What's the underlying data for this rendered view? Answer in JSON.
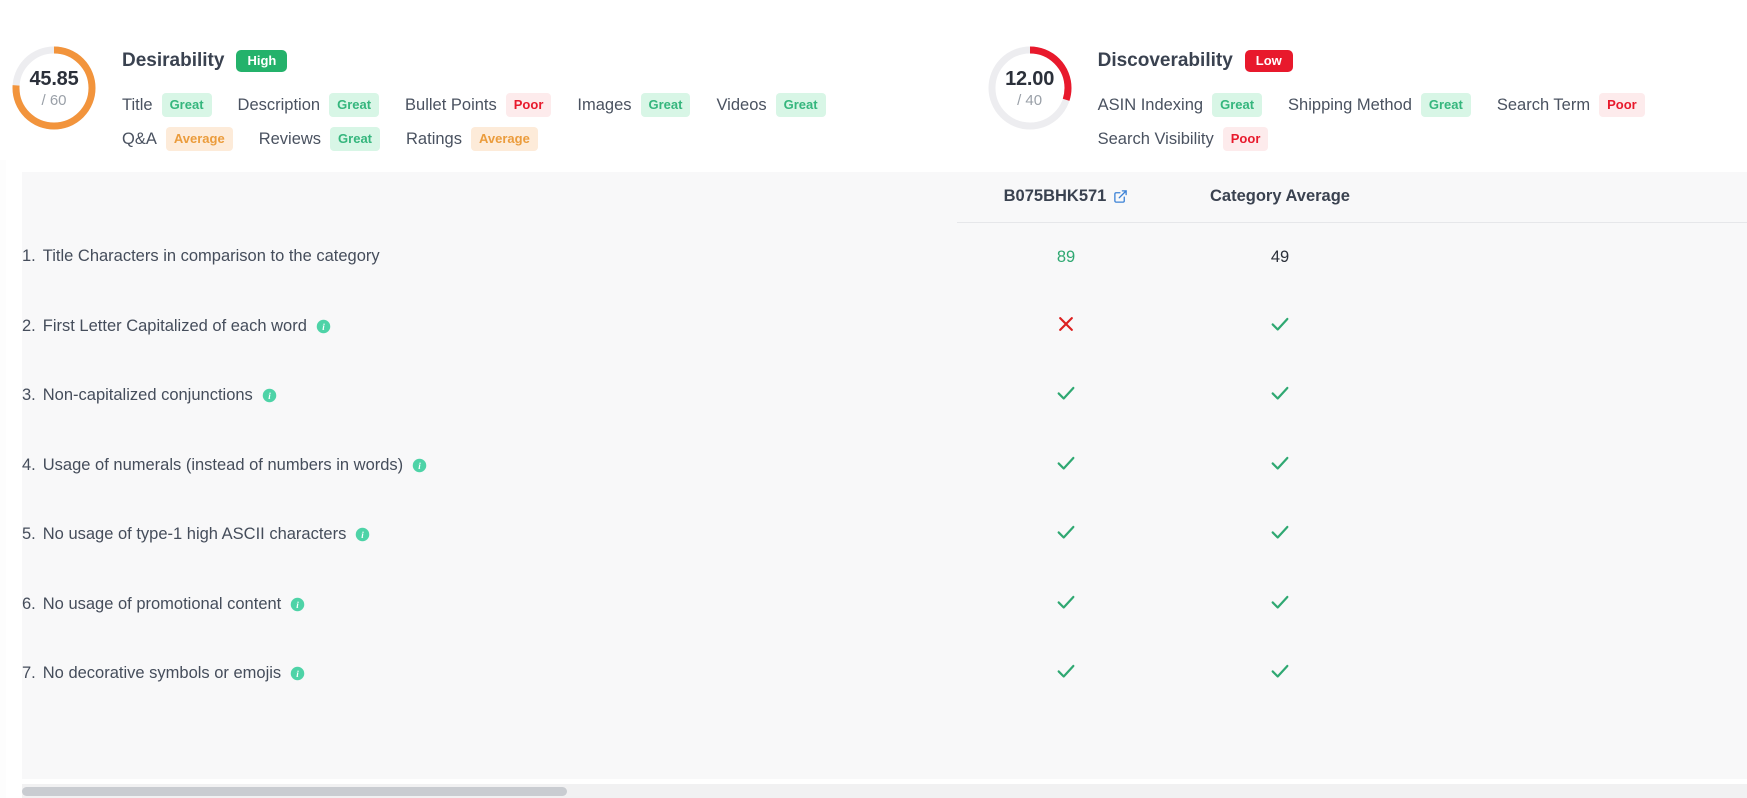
{
  "scores": [
    {
      "key": "desirability",
      "title": "Desirability",
      "rating": "High",
      "rating_style": "high",
      "value": "45.85",
      "total": "/ 60",
      "percent": 76,
      "arc_color": "#f2943c",
      "track_color": "#ededf0",
      "factor_rows": [
        [
          {
            "name": "Title",
            "badge": "Great",
            "badge_style": "b-great"
          },
          {
            "name": "Description",
            "badge": "Great",
            "badge_style": "b-great"
          },
          {
            "name": "Bullet Points",
            "badge": "Poor",
            "badge_style": "b-poor"
          },
          {
            "name": "Images",
            "badge": "Great",
            "badge_style": "b-great"
          },
          {
            "name": "Videos",
            "badge": "Great",
            "badge_style": "b-great"
          }
        ],
        [
          {
            "name": "Q&A",
            "badge": "Average",
            "badge_style": "b-average"
          },
          {
            "name": "Reviews",
            "badge": "Great",
            "badge_style": "b-great"
          },
          {
            "name": "Ratings",
            "badge": "Average",
            "badge_style": "b-average"
          }
        ]
      ]
    },
    {
      "key": "discoverability",
      "title": "Discoverability",
      "rating": "Low",
      "rating_style": "low",
      "value": "12.00",
      "total": "/ 40",
      "percent": 30,
      "arc_color": "#e8192c",
      "track_color": "#ededf0",
      "factor_rows": [
        [
          {
            "name": "ASIN Indexing",
            "badge": "Great",
            "badge_style": "b-great"
          },
          {
            "name": "Shipping Method",
            "badge": "Great",
            "badge_style": "b-great"
          },
          {
            "name": "Search Term",
            "badge": "Poor",
            "badge_style": "b-poor"
          }
        ],
        [
          {
            "name": "Search Visibility",
            "badge": "Poor",
            "badge_style": "b-poor"
          }
        ]
      ]
    }
  ],
  "table": {
    "columns": [
      {
        "label": "",
        "key": "criterion",
        "icon": null
      },
      {
        "label": "B075BHK571",
        "key": "asin",
        "icon": "external-link-icon"
      },
      {
        "label": "Category Average",
        "key": "category_average",
        "icon": null
      }
    ],
    "rows": [
      {
        "num": "1.",
        "label": "Title Characters in comparison to the category",
        "info": false,
        "asin": {
          "type": "number",
          "value": "89",
          "style": "good"
        },
        "category_average": {
          "type": "number",
          "value": "49",
          "style": "neutral"
        }
      },
      {
        "num": "2.",
        "label": "First Letter Capitalized of each word",
        "info": true,
        "asin": {
          "type": "cross",
          "value": "✕"
        },
        "category_average": {
          "type": "check",
          "value": "✓"
        }
      },
      {
        "num": "3.",
        "label": "Non-capitalized conjunctions",
        "info": true,
        "asin": {
          "type": "check",
          "value": "✓"
        },
        "category_average": {
          "type": "check",
          "value": "✓"
        }
      },
      {
        "num": "4.",
        "label": "Usage of numerals (instead of numbers in words)",
        "info": true,
        "asin": {
          "type": "check",
          "value": "✓"
        },
        "category_average": {
          "type": "check",
          "value": "✓"
        }
      },
      {
        "num": "5.",
        "label": "No usage of type-1 high ASCII characters",
        "info": true,
        "asin": {
          "type": "check",
          "value": "✓"
        },
        "category_average": {
          "type": "check",
          "value": "✓"
        }
      },
      {
        "num": "6.",
        "label": "No usage of promotional content",
        "info": true,
        "asin": {
          "type": "check",
          "value": "✓"
        },
        "category_average": {
          "type": "check",
          "value": "✓"
        }
      },
      {
        "num": "7.",
        "label": "No decorative symbols or emojis",
        "info": true,
        "asin": {
          "type": "check",
          "value": "✓"
        },
        "category_average": {
          "type": "check",
          "value": "✓"
        }
      }
    ]
  },
  "colors": {
    "check_green": "#2fa872",
    "cross_red": "#dc2020",
    "info_teal": "#4ed3a7",
    "link_blue": "#3c82d6",
    "orange": "#f2943c",
    "red": "#e8192c",
    "green": "#24b26b"
  },
  "scrollbar": {
    "orientation": "horizontal",
    "thumb_fraction": 0.32
  }
}
